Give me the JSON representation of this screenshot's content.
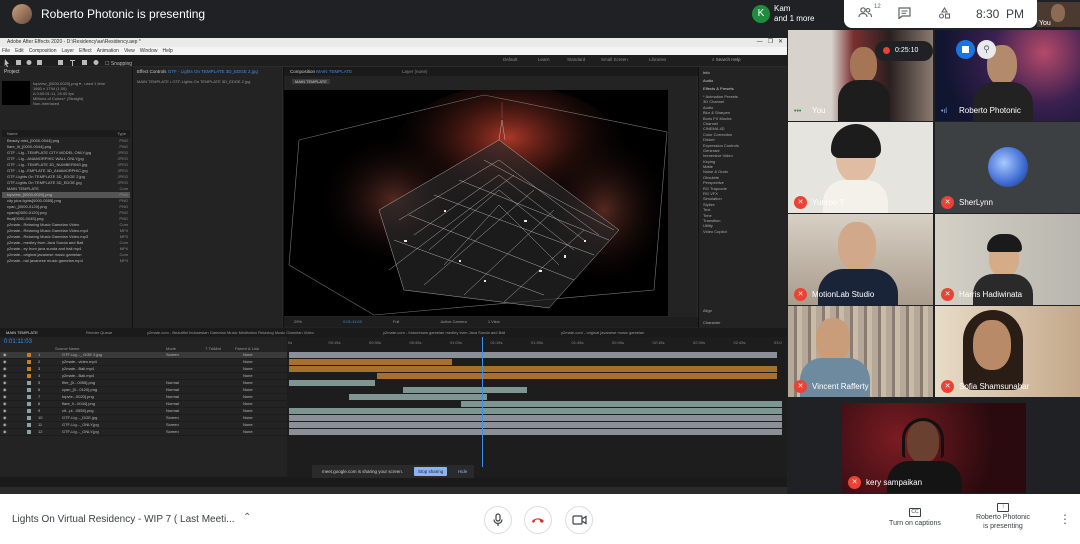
{
  "topbar": {
    "presenting_text": "Roberto Photonic is presenting",
    "kam_initial": "K",
    "kam_name": "Kam",
    "kam_more": "and 1 more",
    "people_count": "12",
    "time": "8:30",
    "meridiem": "PM",
    "self_label": "You"
  },
  "recording": {
    "elapsed": "0:25:10"
  },
  "ae": {
    "window_title": "Adobe After Effects 2020 - D:\\Residency\\ae\\Residency.aep *",
    "menu": [
      "File",
      "Edit",
      "Composition",
      "Layer",
      "Effect",
      "Animation",
      "View",
      "Window",
      "Help"
    ],
    "workspaces": [
      "Default",
      "Learn",
      "Standard",
      "Small Screen",
      "Libraries"
    ],
    "search_help": "Search Help",
    "project_tab": "Project",
    "effect_controls_tab": "Effect Controls",
    "effect_controls_target": "GTF - Lights On TEMPLATE 3D_EDGE 2.jpg",
    "comp_tab": "Composition",
    "comp_name": "MAIN TEMPLATE",
    "layer_tab": "Layer (none)",
    "comp_breadcrumb": "MAIN TEMPLATE",
    "effect_breadcrumb": "MAIN TEMPLATE • GTF-Lights On TEMPLATE 3D_EDGE 2.jpg",
    "proj_item_meta": [
      "topview_[0000-0020].png ▾ , used 1 time",
      "1660 x 1794 (1.00)",
      "Δ 0:00:01:11, 25.00 fps",
      "Millions of Colors+ (Straight)",
      "Non-Interlaced"
    ],
    "proj_col_name": "Name",
    "proj_col_type": "Type",
    "proj_items": [
      {
        "name": "Beauty mist_[0000-0044].png",
        "type": "PNG"
      },
      {
        "name": "flare_lit_[0000-0044].png",
        "type": "PNG"
      },
      {
        "name": "GTF - Lig...TEMPLATE CITY MODEL ONLY.jpg",
        "type": "JPEG"
      },
      {
        "name": "GTF - Lig...ANAMORPHIC WALL ONLY.jpg",
        "type": "JPEG"
      },
      {
        "name": "GTF - Lig...TEMPLATE 3D_NUMBERING.jpg",
        "type": "JPEG"
      },
      {
        "name": "GTF - Lig...EMPLATE 3D_ANAMORPHIC.jpg",
        "type": "JPEG"
      },
      {
        "name": "GTF-Lights On TEMPLATE 3D_EDGE 2.jpg",
        "type": "JPEG"
      },
      {
        "name": "GTF-Lights On TEMPLATE 3D_EDGE.jpg",
        "type": "JPEG"
      },
      {
        "name": "MAIN TEMPLATE",
        "type": "Com"
      },
      {
        "name": "topview_[0000-0020].png",
        "type": "PNG"
      },
      {
        "name": "city plus lights[0000-0555].png",
        "type": "PNG"
      },
      {
        "name": "cyan_[0000-0120].png",
        "type": "PNG"
      },
      {
        "name": "cyans[0000-0120].png",
        "type": "PNG"
      },
      {
        "name": "final[0000-0045].png",
        "type": "PNG"
      },
      {
        "name": "y2mate...Relaxing Music Gamelan Video",
        "type": "Com"
      },
      {
        "name": "y2mate...Relaxing Music Gamelan Video.mp4",
        "type": "MP4"
      },
      {
        "name": "y2mate...Relaxing Music Gamelan Video.mp3",
        "type": "MP3"
      },
      {
        "name": "y2mate...medley from Java Sunda and Bali",
        "type": "Com"
      },
      {
        "name": "y2mate...ey from java sunda and bali.mp4",
        "type": "MP4"
      },
      {
        "name": "y2mate...original javanese music gamelan",
        "type": "Com"
      },
      {
        "name": "y2mate...nal javanese music gamelan.mp4",
        "type": "MP4"
      }
    ],
    "zoom": "29%",
    "timecode_small": "0:01:11:03",
    "resolution": "Full",
    "camera": "Active Camera",
    "view": "1 View",
    "info_items": [
      "Info",
      "Audio",
      "Effects & Presets",
      "* Animation Presets",
      "3D Channel",
      "Audio",
      "Blur & Sharpen",
      "Boris FX Mocha",
      "Channel",
      "CINEMA 4D",
      "Color Correction",
      "Distort",
      "Expression Controls",
      "Generate",
      "Immersive Video",
      "Keying",
      "Matte",
      "Noise & Grain",
      "Obsolete",
      "Perspective",
      "RG Trapcode",
      "RG VFX",
      "Simulation",
      "Stylize",
      "Text",
      "Time",
      "Transition",
      "Utility",
      "Video Copilot"
    ],
    "align_label": "Align",
    "character_label": "Character",
    "timeline_tabs": [
      "MAIN TEMPLATE",
      "Render Queue",
      "y2mate.com - Beautiful Indonesian Gamelan Music Meditation Relaxing Music Gamelan Video",
      "y2mate.com - Indonesian gamelan medley from Java Sunda and Bali",
      "y2mate.com - original javanese music gamelan"
    ],
    "timecode": "0:01:11:03",
    "layer_columns": [
      "Source Name",
      "Mode",
      "T TrkMat",
      "Parent & Link"
    ],
    "layers": [
      {
        "num": "1",
        "name": "GTF-Lig..._ DGE 2.jpg",
        "mode": "Screen",
        "parent": "None",
        "color": "#c77b2a"
      },
      {
        "num": "2",
        "name": "y2mate...video.mp4",
        "mode": "",
        "parent": "None",
        "color": "#c77b2a"
      },
      {
        "num": "3",
        "name": "y2mate...Bali.mp4",
        "mode": "",
        "parent": "None",
        "color": "#c77b2a"
      },
      {
        "num": "4",
        "name": "y2mate...Bali.mp4",
        "mode": "",
        "parent": "None",
        "color": "#c77b2a"
      },
      {
        "num": "5",
        "name": "flire_[0...0055].png",
        "mode": "Normal",
        "parent": "None",
        "color": "#8fa0a0"
      },
      {
        "num": "6",
        "name": "cyan_[0...0120].png",
        "mode": "Normal",
        "parent": "None",
        "color": "#8fa0a0"
      },
      {
        "num": "7",
        "name": "topvie...0020].png",
        "mode": "Normal",
        "parent": "None",
        "color": "#8fa0a0"
      },
      {
        "num": "8",
        "name": "flare_li...0044].png",
        "mode": "Normal",
        "parent": "None",
        "color": "#8fa0a0"
      },
      {
        "num": "9",
        "name": "cit...pl...0555].png",
        "mode": "Normal",
        "parent": "None",
        "color": "#8fa0a0"
      },
      {
        "num": "10",
        "name": "GTF-Lig..._DGE.jpg",
        "mode": "Screen",
        "parent": "None",
        "color": "#8fa0a0"
      },
      {
        "num": "11",
        "name": "GTF-Lig..._ONLY.jpg",
        "mode": "Screen",
        "parent": "None",
        "color": "#8fa0a0"
      },
      {
        "num": "12",
        "name": "GTF-Lig..._ONLY.jpg",
        "mode": "Screen",
        "parent": "None",
        "color": "#8fa0a0"
      }
    ],
    "ruler_ticks": [
      "0s",
      "00:15s",
      "00:30s",
      "00:45s",
      "01:00s",
      "01:15s",
      "01:30s",
      "01:45s",
      "02:00s",
      "02:15s",
      "02:30s",
      "02:45s",
      "03:0"
    ]
  },
  "share_banner": {
    "text": "meet.google.com is sharing your screen.",
    "stop_label": "Stop sharing",
    "hide_label": "Hide"
  },
  "participants": [
    {
      "name": "You",
      "muted": false
    },
    {
      "name": "Roberto Photonic",
      "muted": false
    },
    {
      "name": "Yunroo T",
      "muted": true
    },
    {
      "name": "SherLynn",
      "muted": true
    },
    {
      "name": "MotionLab Studio",
      "muted": true
    },
    {
      "name": "Harris Hadiwinata",
      "muted": true
    },
    {
      "name": "Vincent Rafferty",
      "muted": true
    },
    {
      "name": "Sofia Shamsunahar",
      "muted": true
    },
    {
      "name": "kery sampaikan",
      "muted": true
    }
  ],
  "bottombar": {
    "meeting_title": "Lights On Virtual Residency - WIP 7 ( Last Meeti...",
    "captions_label": "Turn on captions",
    "presenting_line1": "Roberto Photonic",
    "presenting_line2": "is presenting"
  },
  "colors": {
    "accent_blue": "#1a73e8",
    "mic_off_red": "#ea4335",
    "end_call_red": "#d93025",
    "ae_blue": "#3b8eea",
    "layer_orange": "#c77b2a"
  }
}
